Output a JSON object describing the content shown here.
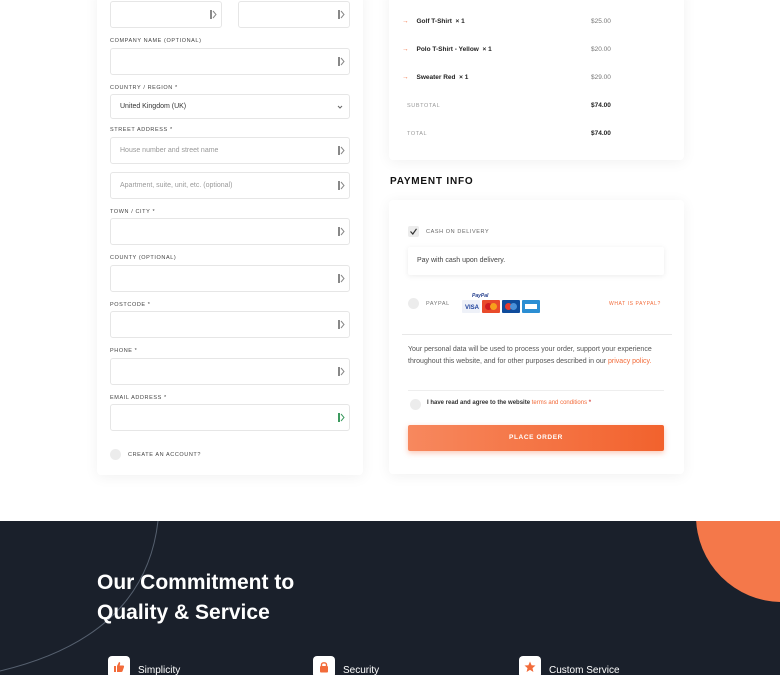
{
  "billing": {
    "company_label": "COMPANY NAME (OPTIONAL)",
    "country_label": "COUNTRY / REGION *",
    "country_value": "United Kingdom (UK)",
    "street_label": "STREET ADDRESS *",
    "street1_placeholder": "House number and street name",
    "street2_placeholder": "Apartment, suite, unit, etc. (optional)",
    "town_label": "TOWN / CITY *",
    "county_label": "COUNTY (OPTIONAL)",
    "postcode_label": "POSTCODE *",
    "phone_label": "PHONE *",
    "email_label": "EMAIL ADDRESS *",
    "create_account_label": "CREATE AN ACCOUNT?"
  },
  "order": {
    "items": [
      {
        "name": "Golf T-Shirt",
        "qty": "× 1",
        "price": "$25.00"
      },
      {
        "name": "Polo T-Shirt - Yellow",
        "qty": "× 1",
        "price": "$20.00"
      },
      {
        "name": "Sweater Red",
        "qty": "× 1",
        "price": "$29.00"
      }
    ],
    "subtotal_label": "SUBTOTAL",
    "subtotal_value": "$74.00",
    "total_label": "TOTAL",
    "total_value": "$74.00"
  },
  "payment": {
    "heading": "PAYMENT INFO",
    "cod_label": "CASH ON DELIVERY",
    "cod_description": "Pay with cash upon delivery.",
    "paypal_label": "PAYPAL",
    "paypal_logo_text": "PayPal",
    "what_is_paypal": "WHAT IS PAYPAL?",
    "privacy_text": "Your personal data will be used to process your order, support your experience throughout this website, and for other purposes described in our",
    "privacy_link": "privacy policy.",
    "terms_text": "I have read and agree to the website",
    "terms_link": "terms and conditions",
    "terms_star": "*",
    "place_order": "PLACE ORDER"
  },
  "footer": {
    "title_line1": "Our Commitment to",
    "title_line2": "Quality & Service",
    "features": [
      {
        "label": "Simplicity",
        "icon": "thumbs-up-icon"
      },
      {
        "label": "Security",
        "icon": "lock-icon"
      },
      {
        "label": "Custom Service",
        "icon": "star-icon"
      }
    ]
  },
  "colors": {
    "accent": "#f26b3a",
    "footer_bg": "#1a202b",
    "link": "#f26b3a"
  }
}
